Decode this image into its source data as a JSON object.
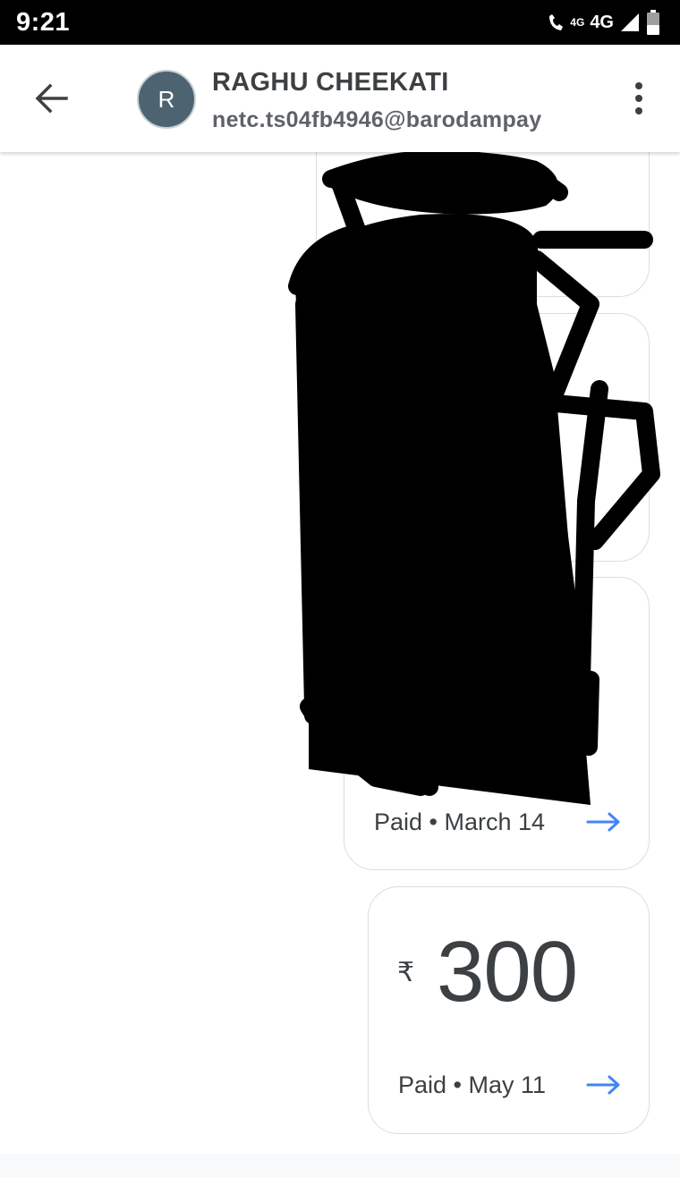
{
  "status_bar": {
    "time": "9:21",
    "call_lte_label": "4G",
    "network_label": "4G"
  },
  "header": {
    "avatar_initial": "R",
    "contact_name": "RAGHU CHEEKATI",
    "contact_handle": "netc.ts04fb4946@barodampay"
  },
  "transactions": [
    {
      "status_label": "Paid • March 14"
    },
    {
      "currency_symbol": "₹",
      "amount": "300",
      "status_label": "Paid • May 11"
    }
  ],
  "colors": {
    "accent_arrow": "#4285f4",
    "avatar_bg": "#4d6371"
  },
  "icons": {
    "back": "arrow-left-icon",
    "more": "more-vert-icon",
    "card_arrow": "arrow-right-icon"
  }
}
